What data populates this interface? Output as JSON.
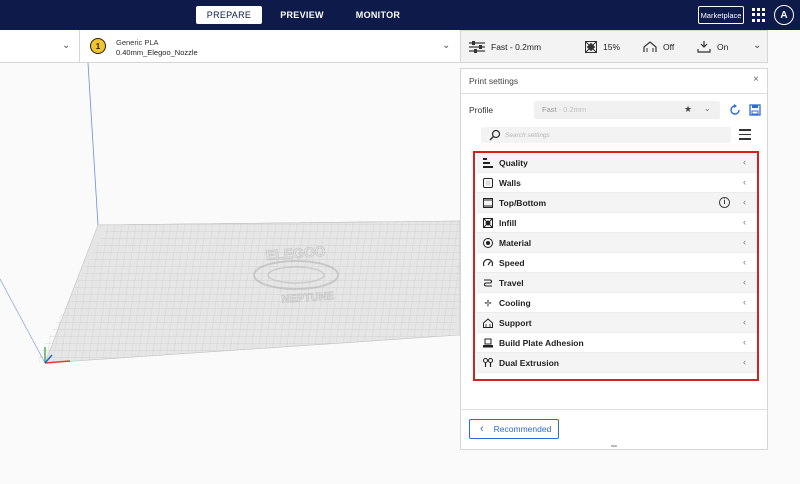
{
  "header": {
    "stages": [
      {
        "label": "PREPARE",
        "active": true
      },
      {
        "label": "PREVIEW",
        "active": false
      },
      {
        "label": "MONITOR",
        "active": false
      }
    ],
    "marketplace_label": "Marketplace",
    "account_initial": "A"
  },
  "toolbar": {
    "extruder_number": "1",
    "material_name": "Generic PLA",
    "nozzle_name": "0.40mm_Elegoo_Nozzle"
  },
  "print_setup": {
    "profile": "Fast - 0.2mm",
    "infill": "15%",
    "support": "Off",
    "adhesion": "On"
  },
  "viewport": {
    "bed_logo_top": "ELEGOO",
    "bed_logo_bottom": "NEPTUNE"
  },
  "panel": {
    "title": "Print settings",
    "close_glyph": "×",
    "profile_label": "Profile",
    "profile_name": "Fast",
    "profile_layer": " - 0.2mm",
    "search_placeholder": "Search settings",
    "categories": [
      {
        "label": "Quality",
        "icon": "quality-icon"
      },
      {
        "label": "Walls",
        "icon": "walls-icon"
      },
      {
        "label": "Top/Bottom",
        "icon": "top-bottom-icon"
      },
      {
        "label": "Infill",
        "icon": "infill-icon"
      },
      {
        "label": "Material",
        "icon": "material-icon"
      },
      {
        "label": "Speed",
        "icon": "speed-icon"
      },
      {
        "label": "Travel",
        "icon": "travel-icon"
      },
      {
        "label": "Cooling",
        "icon": "cooling-icon"
      },
      {
        "label": "Support",
        "icon": "support-icon"
      },
      {
        "label": "Build Plate Adhesion",
        "icon": "build-plate-adhesion-icon"
      },
      {
        "label": "Dual Extrusion",
        "icon": "dual-extrusion-icon"
      }
    ],
    "info_glyph": "i",
    "recommended_label": "Recommended"
  },
  "colors": {
    "header_bg": "#0d1a4a",
    "accent_blue": "#2d6ad6",
    "highlight_red": "#d42020",
    "extruder_yellow": "#f2c32a"
  }
}
